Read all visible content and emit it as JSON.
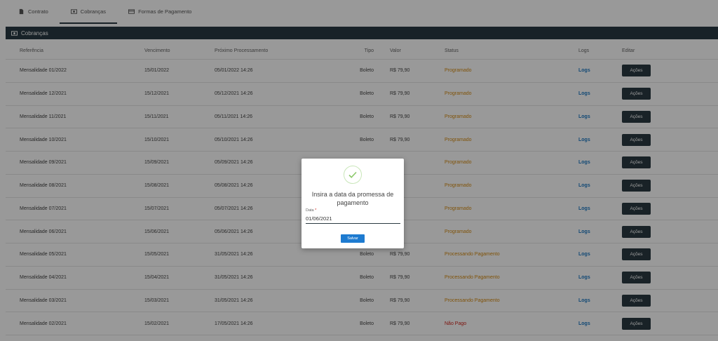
{
  "tabs": [
    {
      "label": "Contrato",
      "icon": "document-icon",
      "active": false
    },
    {
      "label": "Cobranças",
      "icon": "money-icon",
      "active": true
    },
    {
      "label": "Formas de Pagamento",
      "icon": "card-icon",
      "active": false
    }
  ],
  "section": {
    "title": "Cobranças",
    "icon": "money-icon"
  },
  "table": {
    "headers": [
      "Referência",
      "Vencimento",
      "Próximo Processamento",
      "Tipo",
      "Valor",
      "Status",
      "Logs",
      "Editar"
    ],
    "rows": [
      {
        "ref": "Mensalidade 01/2022",
        "venc": "15/01/2022",
        "proc": "05/01/2022 14:26",
        "tipo": "Boleto",
        "valor": "R$ 79,90",
        "status": "Programado",
        "status_type": "prog",
        "logs": "Logs",
        "acao": "Ações"
      },
      {
        "ref": "Mensalidade 12/2021",
        "venc": "15/12/2021",
        "proc": "05/12/2021 14:26",
        "tipo": "Boleto",
        "valor": "R$ 79,90",
        "status": "Programado",
        "status_type": "prog",
        "logs": "Logs",
        "acao": "Ações"
      },
      {
        "ref": "Mensalidade 11/2021",
        "venc": "15/11/2021",
        "proc": "05/11/2021 14:26",
        "tipo": "Boleto",
        "valor": "R$ 79,90",
        "status": "Programado",
        "status_type": "prog",
        "logs": "Logs",
        "acao": "Ações"
      },
      {
        "ref": "Mensalidade 10/2021",
        "venc": "15/10/2021",
        "proc": "05/10/2021 14:26",
        "tipo": "Boleto",
        "valor": "R$ 79,90",
        "status": "Programado",
        "status_type": "prog",
        "logs": "Logs",
        "acao": "Ações"
      },
      {
        "ref": "Mensalidade 09/2021",
        "venc": "15/09/2021",
        "proc": "05/09/2021 14:26",
        "tipo": "",
        "valor": "",
        "status": "Programado",
        "status_type": "prog",
        "logs": "Logs",
        "acao": "Ações"
      },
      {
        "ref": "Mensalidade 08/2021",
        "venc": "15/08/2021",
        "proc": "05/08/2021 14:26",
        "tipo": "",
        "valor": "",
        "status": "Programado",
        "status_type": "prog",
        "logs": "Logs",
        "acao": "Ações"
      },
      {
        "ref": "Mensalidade 07/2021",
        "venc": "15/07/2021",
        "proc": "05/07/2021 14:26",
        "tipo": "",
        "valor": "",
        "status": "Programado",
        "status_type": "prog",
        "logs": "Logs",
        "acao": "Ações"
      },
      {
        "ref": "Mensalidade 06/2021",
        "venc": "15/06/2021",
        "proc": "05/06/2021 14:26",
        "tipo": "",
        "valor": "",
        "status": "Programado",
        "status_type": "prog",
        "logs": "Logs",
        "acao": "Ações"
      },
      {
        "ref": "Mensalidade 05/2021",
        "venc": "15/05/2021",
        "proc": "31/05/2021 14:26",
        "tipo": "Boleto",
        "valor": "R$ 79,90",
        "status": "Processando Pagamento",
        "status_type": "proc",
        "logs": "Logs",
        "acao": "Ações"
      },
      {
        "ref": "Mensalidade 04/2021",
        "venc": "15/04/2021",
        "proc": "31/05/2021 14:26",
        "tipo": "Boleto",
        "valor": "R$ 79,90",
        "status": "Processando Pagamento",
        "status_type": "proc",
        "logs": "Logs",
        "acao": "Ações"
      },
      {
        "ref": "Mensalidade 03/2021",
        "venc": "15/03/2021",
        "proc": "31/05/2021 14:26",
        "tipo": "Boleto",
        "valor": "R$ 79,90",
        "status": "Processando Pagamento",
        "status_type": "proc",
        "logs": "Logs",
        "acao": "Ações"
      },
      {
        "ref": "Mensalidade 02/2021",
        "venc": "15/02/2021",
        "proc": "17/05/2021 14:26",
        "tipo": "Boleto",
        "valor": "R$ 79,90",
        "status": "Não Pago",
        "status_type": "nao",
        "logs": "Logs",
        "acao": "Ações"
      }
    ]
  },
  "modal": {
    "icon": "check-circle-icon",
    "title": "Insira a data da promessa de pagamento",
    "field_label": "Data",
    "required_mark": "*",
    "field_value": "01/06/2021",
    "save_label": "Salvar"
  },
  "colors": {
    "header_bar": "#283a43",
    "button_dark": "#2b3a42",
    "status_programado": "#d58a0f",
    "status_nao_pago": "#d0231a",
    "link": "#1f7ac4",
    "save_button": "#1e7bd0"
  }
}
